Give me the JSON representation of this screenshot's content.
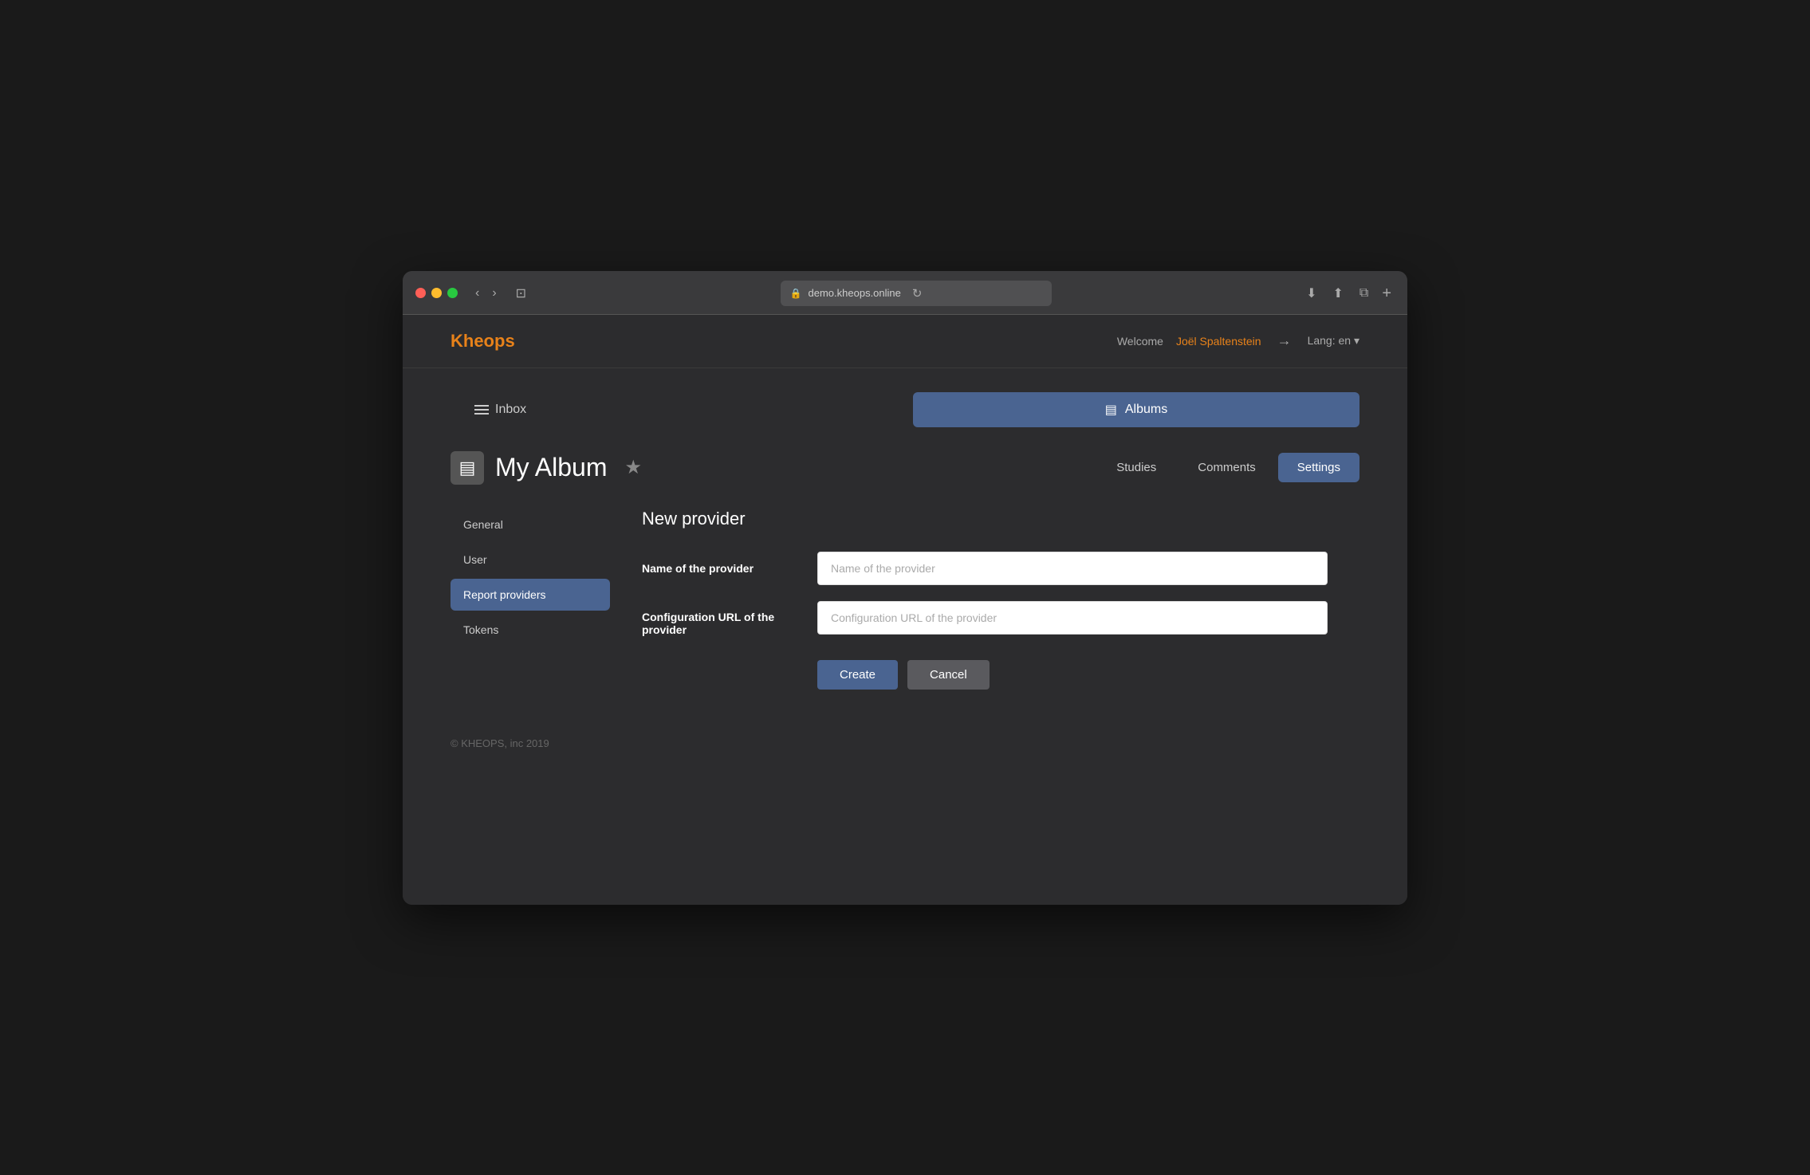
{
  "browser": {
    "url": "demo.kheops.online",
    "nav_back": "‹",
    "nav_forward": "›",
    "reload": "↻",
    "download_icon": "⬇",
    "share_icon": "⬆",
    "copy_icon": "⧉",
    "new_tab": "+"
  },
  "header": {
    "logo": "Kheops",
    "welcome_prefix": "Welcome",
    "user_name": "Joël Spaltenstein",
    "logout_icon": "→",
    "lang": "Lang: en",
    "lang_arrow": "▾"
  },
  "tabs": {
    "inbox_label": "Inbox",
    "albums_label": "Albums",
    "albums_icon": "▤"
  },
  "album": {
    "title": "My Album",
    "icon": "▤",
    "star": "★",
    "tab_studies": "Studies",
    "tab_comments": "Comments",
    "tab_settings": "Settings"
  },
  "settings_sidebar": {
    "items": [
      {
        "label": "General",
        "active": false
      },
      {
        "label": "User",
        "active": false
      },
      {
        "label": "Report providers",
        "active": true
      },
      {
        "label": "Tokens",
        "active": false
      }
    ]
  },
  "form": {
    "title": "New provider",
    "name_label": "Name of the provider",
    "name_placeholder": "Name of the provider",
    "url_label": "Configuration URL of the provider",
    "url_placeholder": "Configuration URL of the provider",
    "create_btn": "Create",
    "cancel_btn": "Cancel"
  },
  "footer": {
    "text": "© KHEOPS, inc 2019"
  }
}
